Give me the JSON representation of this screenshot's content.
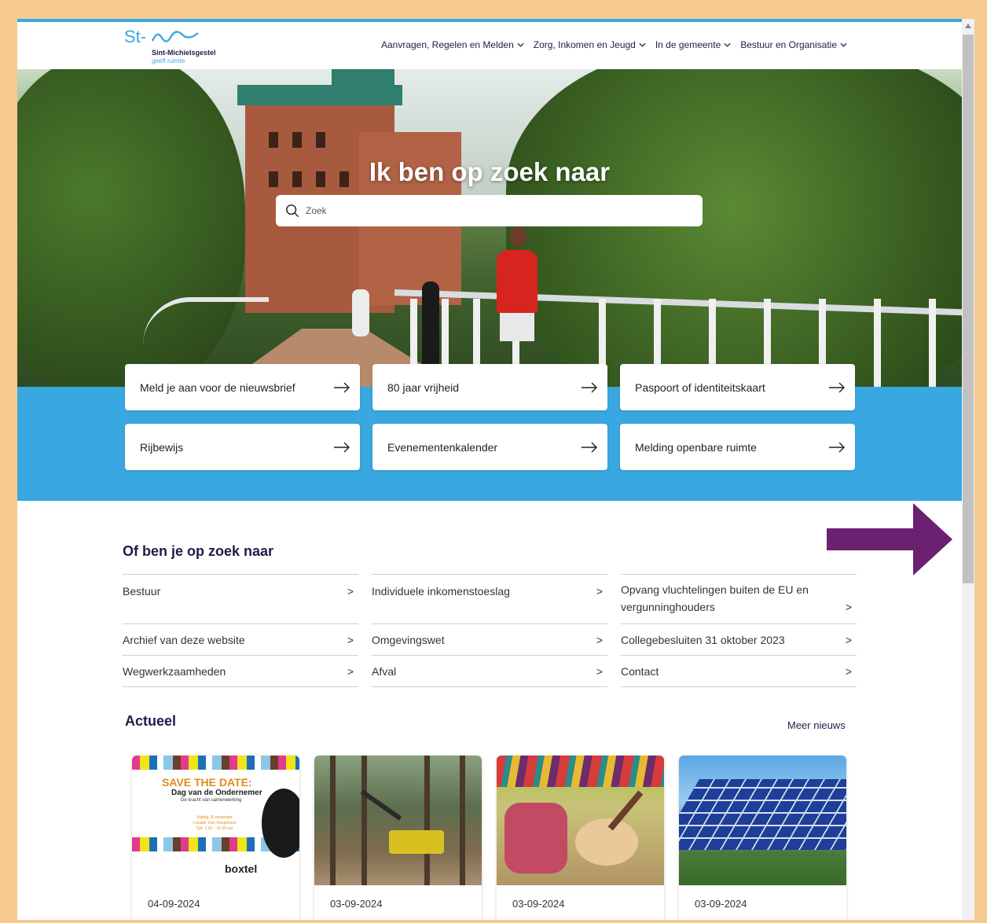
{
  "header": {
    "logo_name": "Sint-Michielsgestel",
    "logo_tagline": "geeft ruimte",
    "nav": [
      {
        "label": "Aanvragen, Regelen en Melden"
      },
      {
        "label": "Zorg, Inkomen en Jeugd"
      },
      {
        "label": "In de gemeente"
      },
      {
        "label": "Bestuur en Organisatie"
      }
    ]
  },
  "hero": {
    "title": "Ik ben op zoek naar",
    "search_placeholder": "Zoek"
  },
  "tiles": [
    {
      "label": "Meld je aan voor de nieuwsbrief"
    },
    {
      "label": "80 jaar vrijheid"
    },
    {
      "label": "Paspoort of identiteitskaart"
    },
    {
      "label": "Rijbewijs"
    },
    {
      "label": "Evenementenkalender"
    },
    {
      "label": "Melding openbare ruimte"
    }
  ],
  "secondary": {
    "title": "Of ben je op zoek naar",
    "links": [
      {
        "label": "Bestuur"
      },
      {
        "label": "Individuele inkomenstoeslag"
      },
      {
        "label": "Opvang vluchtelingen buiten de EU en vergunninghouders"
      },
      {
        "label": "Archief van deze website"
      },
      {
        "label": "Omgevingswet"
      },
      {
        "label": "Collegebesluiten 31 oktober 2023"
      },
      {
        "label": "Wegwerkzaamheden"
      },
      {
        "label": "Afval"
      },
      {
        "label": "Contact"
      }
    ],
    "chevron": ">"
  },
  "news": {
    "title": "Actueel",
    "more": "Meer nieuws",
    "cards": [
      {
        "date": "04-09-2024",
        "image": "save-the-date-flyer",
        "save_the_date": "SAVE THE DATE:",
        "event": "Dag van de Ondernemer",
        "tagline": "De kracht van samenwerking",
        "details": "Vrijdag 15 november\nLocatie: Dun Dunpsherd\nTijd: 7.30 – 10.30 uur",
        "brand": "boxtel"
      },
      {
        "date": "03-09-2024",
        "image": "forest-harvester"
      },
      {
        "date": "03-09-2024",
        "image": "guitar-on-blanket"
      },
      {
        "date": "03-09-2024",
        "image": "solar-panels"
      }
    ]
  },
  "colors": {
    "accent_blue": "#3aa8e0",
    "navy": "#1d1d4a",
    "purple_annotation": "#6b2070",
    "frame": "#f6c98f"
  },
  "icons": {
    "tile_arrow": "arrow-right-icon",
    "nav_chevron": "chevron-down-icon",
    "search": "search-icon"
  }
}
